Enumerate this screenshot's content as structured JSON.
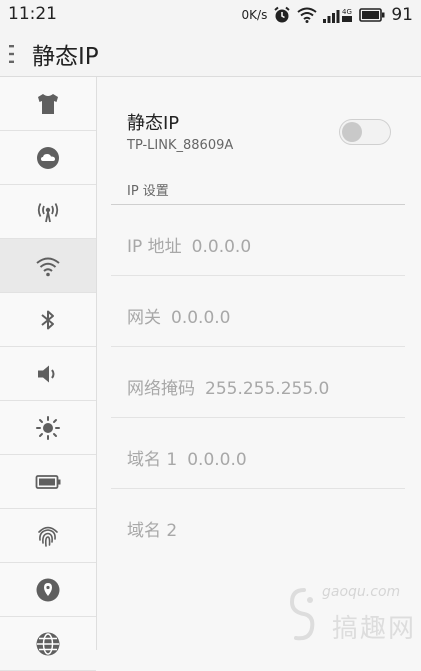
{
  "status_bar": {
    "time": "11:21",
    "net_speed": "0K/s",
    "network_type": "4G",
    "battery_level": "91",
    "icons": [
      "alarm-icon",
      "wifi-icon",
      "signal-icon",
      "battery-icon"
    ]
  },
  "title_bar": {
    "title": "静态IP"
  },
  "sidebar": {
    "items": [
      {
        "icon": "theme-shirt-icon",
        "active": false
      },
      {
        "icon": "cloud-icon",
        "active": false
      },
      {
        "icon": "hotspot-icon",
        "active": false
      },
      {
        "icon": "wifi-icon",
        "active": true
      },
      {
        "icon": "bluetooth-icon",
        "active": false
      },
      {
        "icon": "volume-icon",
        "active": false
      },
      {
        "icon": "brightness-icon",
        "active": false
      },
      {
        "icon": "battery-icon",
        "active": false
      },
      {
        "icon": "fingerprint-icon",
        "active": false
      },
      {
        "icon": "location-icon",
        "active": false
      },
      {
        "icon": "globe-icon",
        "active": false
      }
    ]
  },
  "static_ip": {
    "label": "静态IP",
    "ssid": "TP-LINK_88609A",
    "enabled": false
  },
  "ip_settings": {
    "section_label": "IP 设置",
    "fields": [
      {
        "label": "IP 地址",
        "value": "0.0.0.0"
      },
      {
        "label": "网关",
        "value": "0.0.0.0"
      },
      {
        "label": "网络掩码",
        "value": "255.255.255.0"
      },
      {
        "label": "域名 1",
        "value": "0.0.0.0"
      },
      {
        "label": "域名 2",
        "value": ""
      }
    ]
  },
  "watermark": {
    "url": "gaoqu.com",
    "name": "搞趣网"
  },
  "colors": {
    "accent_gray": "#5f5f5f",
    "field_text": "#a8a8a8",
    "active_row": "#e9e9e9"
  }
}
